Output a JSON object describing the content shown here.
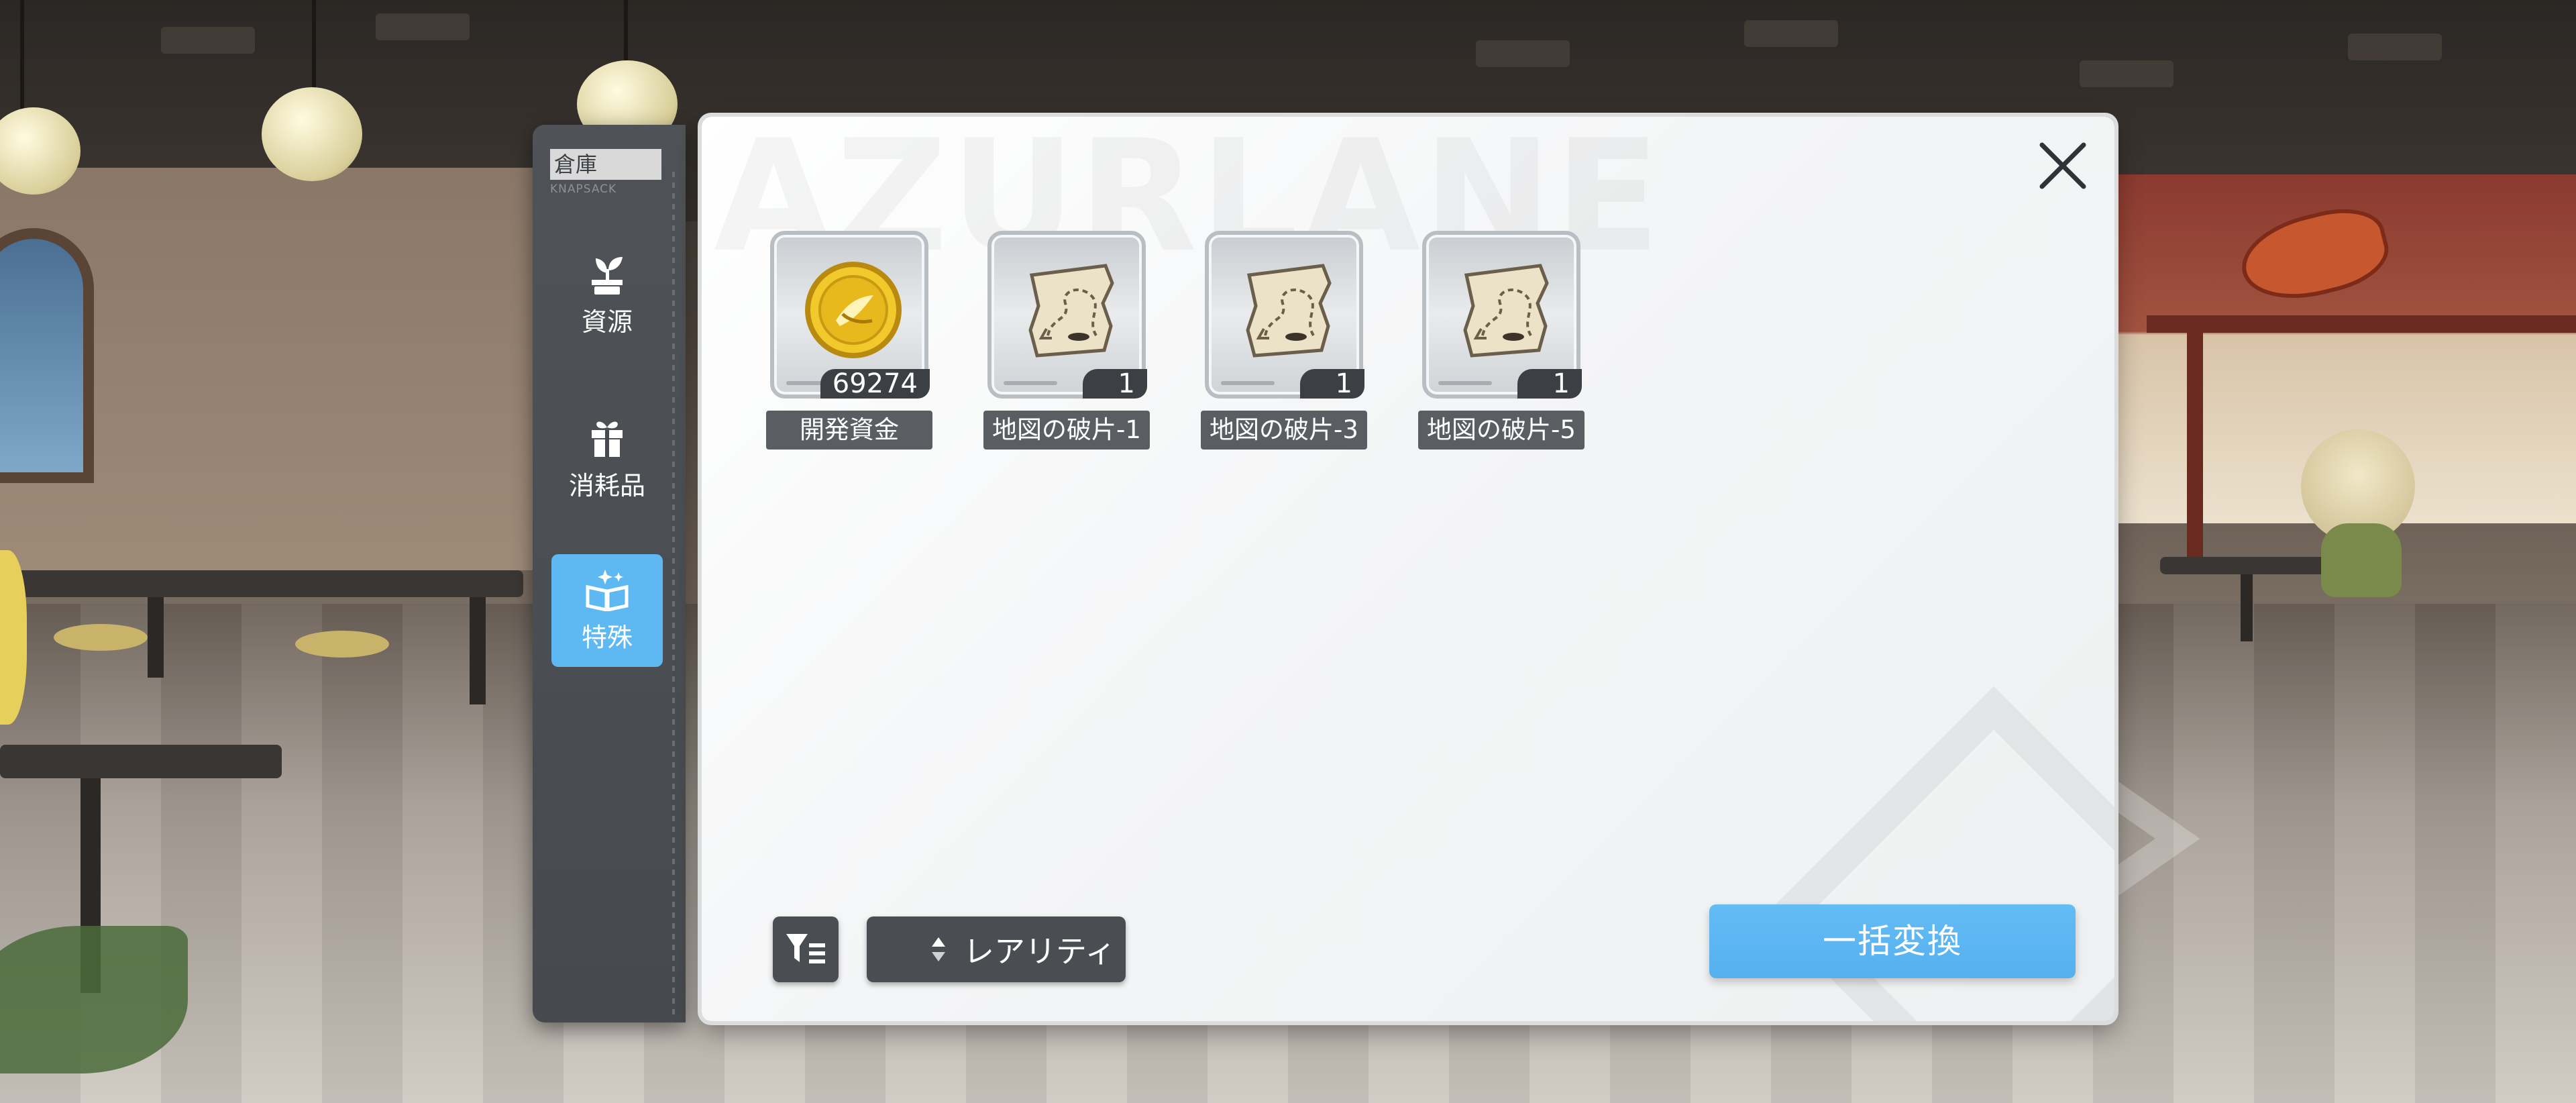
{
  "watermark": "AZURLANE",
  "sidebar": {
    "title": "倉庫",
    "subtitle": "KNAPSACK",
    "tabs": [
      {
        "label": "資源",
        "icon": "sprout-icon",
        "active": false
      },
      {
        "label": "消耗品",
        "icon": "gift-box-icon",
        "active": false
      },
      {
        "label": "特殊",
        "icon": "sparkle-book-icon",
        "active": true
      }
    ]
  },
  "items": [
    {
      "name": "開発資金",
      "count": "69274",
      "icon": "gold-coin-icon"
    },
    {
      "name": "地図の破片-1",
      "count": "1",
      "icon": "map-fragment-icon"
    },
    {
      "name": "地図の破片-3",
      "count": "1",
      "icon": "map-fragment-icon"
    },
    {
      "name": "地図の破片-5",
      "count": "1",
      "icon": "map-fragment-icon"
    }
  ],
  "controls": {
    "sort_label": "レアリティ",
    "bulk_convert_label": "一括変換",
    "filter_icon": "filter-list-icon",
    "sort_icon": "sort-updown-icon",
    "close_icon": "close-icon"
  },
  "colors": {
    "accent": "#5eb9f3",
    "sidebar_bg": "#4a4e53",
    "label_bg": "#5a5e63",
    "panel_bg": "#f4f5f6"
  }
}
